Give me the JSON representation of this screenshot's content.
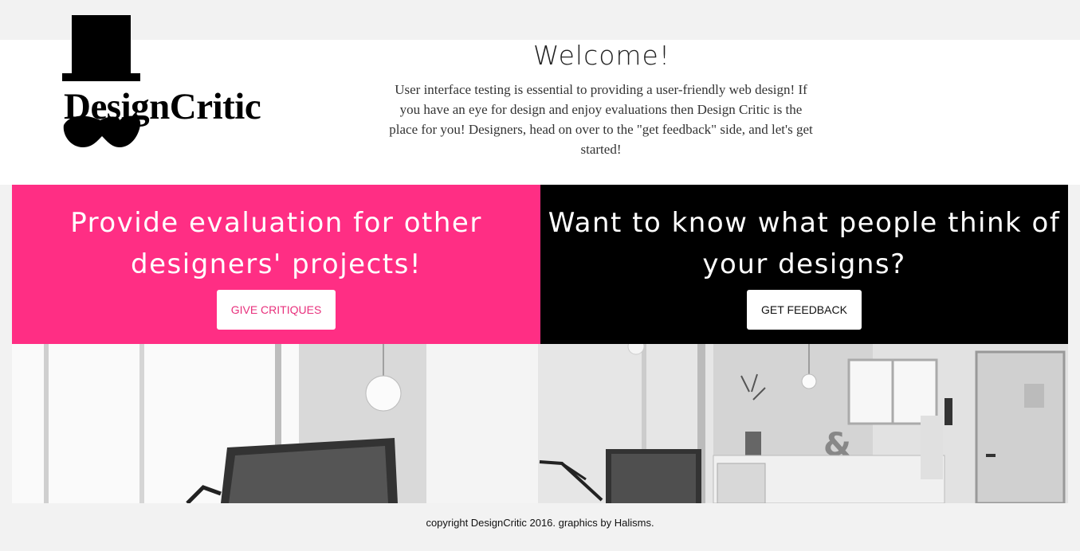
{
  "header": {
    "logo_text": "DesignCritic",
    "welcome_title": "Welcome!",
    "welcome_text": "User interface testing is essential to providing a user-friendly web design! If you have an eye for design and enjoy evaluations then Design Critic is the place for you! Designers, head on over to the \"get feedback\" side, and let's get started!"
  },
  "panels": {
    "left": {
      "heading": "Provide evaluation for other designers' projects!",
      "button_label": "GIVE CRITIQUES",
      "background": "#ff2e84",
      "button_text_color": "#e8307c"
    },
    "right": {
      "heading": "Want to know what people think of your designs?",
      "button_label": "GET FEEDBACK",
      "background": "#000000"
    }
  },
  "hero_image": {
    "icon": "office-photo-image",
    "description_glyph": "&"
  },
  "footer": {
    "text": "copyright DesignCritic 2016. graphics by Halisms."
  }
}
